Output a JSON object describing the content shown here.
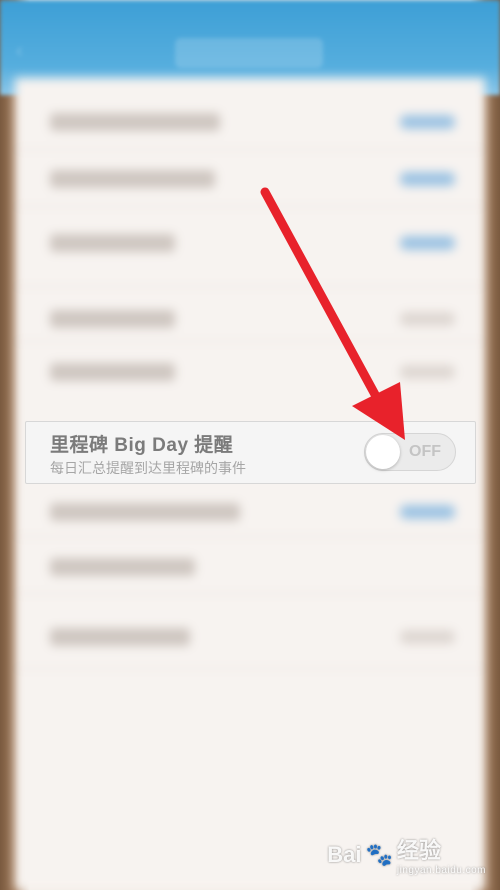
{
  "setting": {
    "title": "里程碑 Big Day 提醒",
    "subtitle": "每日汇总提醒到达里程碑的事件",
    "toggle": {
      "state": "OFF",
      "checked": false
    }
  },
  "watermark": {
    "brand": "Bai",
    "brand2": "经验",
    "url": "jingyan.baidu.com"
  },
  "colors": {
    "header": "#3d9fd6",
    "arrow": "#e8222b"
  }
}
